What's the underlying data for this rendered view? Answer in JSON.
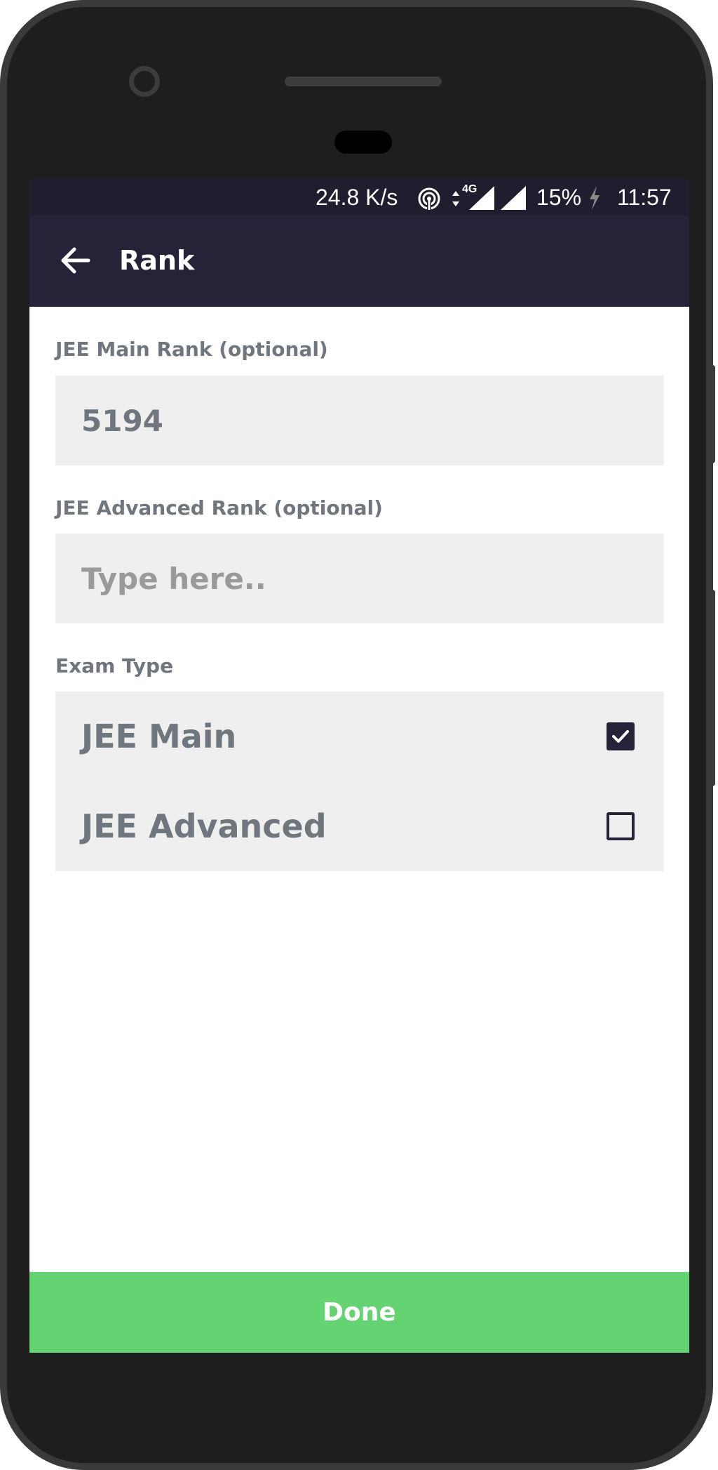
{
  "status_bar": {
    "net_speed": "24.8 K/s",
    "network": "4G",
    "battery": "15%",
    "time": "11:57",
    "icons": [
      "hotspot-icon",
      "data-arrows-icon",
      "signal-icon",
      "signal-icon",
      "charging-icon"
    ]
  },
  "app_bar": {
    "title": "Rank",
    "back_icon": "arrow-left-icon"
  },
  "form": {
    "main_rank": {
      "label": "JEE Main Rank (optional)",
      "value": "5194",
      "placeholder": "Type here.."
    },
    "advanced_rank": {
      "label": "JEE Advanced Rank (optional)",
      "value": "",
      "placeholder": "Type here.."
    },
    "exam_type": {
      "label": "Exam Type",
      "options": [
        {
          "label": "JEE Main",
          "checked": true
        },
        {
          "label": "JEE Advanced",
          "checked": false
        }
      ]
    }
  },
  "done_label": "Done",
  "colors": {
    "app_bar": "#252338",
    "status_bar": "#1f1d2e",
    "done_button": "#63d471",
    "field_bg": "#efefef",
    "label_text": "#6f767d"
  }
}
